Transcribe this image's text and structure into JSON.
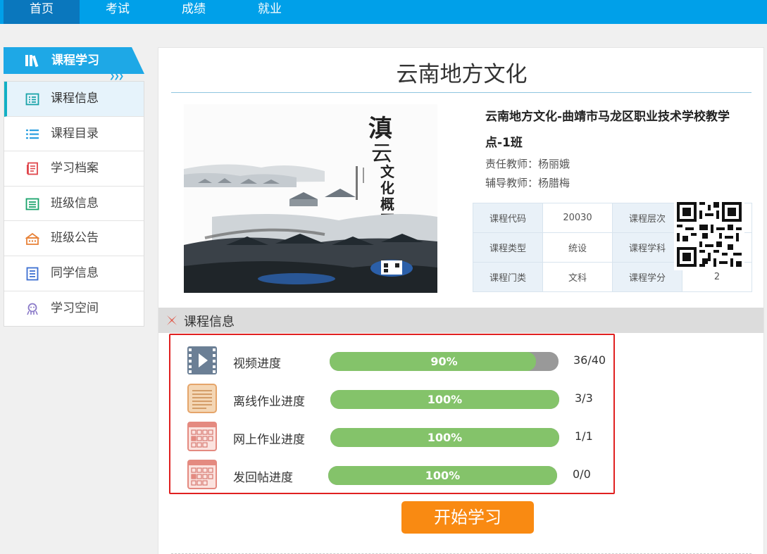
{
  "nav": {
    "items": [
      {
        "label": "首页",
        "active": true
      },
      {
        "label": "考试",
        "active": false
      },
      {
        "label": "成绩",
        "active": false
      },
      {
        "label": "就业",
        "active": false
      }
    ]
  },
  "sidebar": {
    "header": "课程学习",
    "items": [
      {
        "label": "课程信息",
        "icon": "list-icon",
        "active": true
      },
      {
        "label": "课程目录",
        "icon": "catalog-icon",
        "active": false
      },
      {
        "label": "学习档案",
        "icon": "archive-icon",
        "active": false
      },
      {
        "label": "班级信息",
        "icon": "class-info-icon",
        "active": false
      },
      {
        "label": "班级公告",
        "icon": "announcement-icon",
        "active": false
      },
      {
        "label": "同学信息",
        "icon": "classmates-icon",
        "active": false
      },
      {
        "label": "学习空间",
        "icon": "study-space-icon",
        "active": false
      }
    ]
  },
  "course": {
    "title": "云南地方文化",
    "full_name": "云南地方文化-曲靖市马龙区职业技术学校教学点-1班",
    "head_teacher": "责任教师：杨丽娥",
    "tutor": "辅导教师：杨腊梅",
    "cover": {
      "title_chars": [
        "滇",
        "云",
        "文",
        "化",
        "概",
        "要"
      ]
    },
    "table": [
      [
        {
          "k": "课程代码",
          "v": "20030"
        },
        {
          "k": "课程层次",
          "v": ""
        }
      ],
      [
        {
          "k": "课程类型",
          "v": "统设"
        },
        {
          "k": "课程学科",
          "v": ""
        }
      ],
      [
        {
          "k": "课程门类",
          "v": "文科"
        },
        {
          "k": "课程学分",
          "v": "2"
        }
      ]
    ]
  },
  "section": {
    "title": "课程信息"
  },
  "progress": [
    {
      "label": "视频进度",
      "percent": 90,
      "percent_text": "90%",
      "count": "36/40",
      "icon": "video-icon"
    },
    {
      "label": "离线作业进度",
      "percent": 100,
      "percent_text": "100%",
      "count": "3/3",
      "icon": "document-icon"
    },
    {
      "label": "网上作业进度",
      "percent": 100,
      "percent_text": "100%",
      "count": "1/1",
      "icon": "calendar-icon"
    },
    {
      "label": "发回帖进度",
      "percent": 100,
      "percent_text": "100%",
      "count": "0/0",
      "icon": "calendar-icon"
    }
  ],
  "start_button": "开始学习",
  "colors": {
    "nav_bg": "#00a0e9",
    "nav_active": "#0a77bd",
    "progress_fill": "#84c36a",
    "progress_track": "#999999",
    "start_button": "#f98a12",
    "highlight_border": "#e02020"
  }
}
